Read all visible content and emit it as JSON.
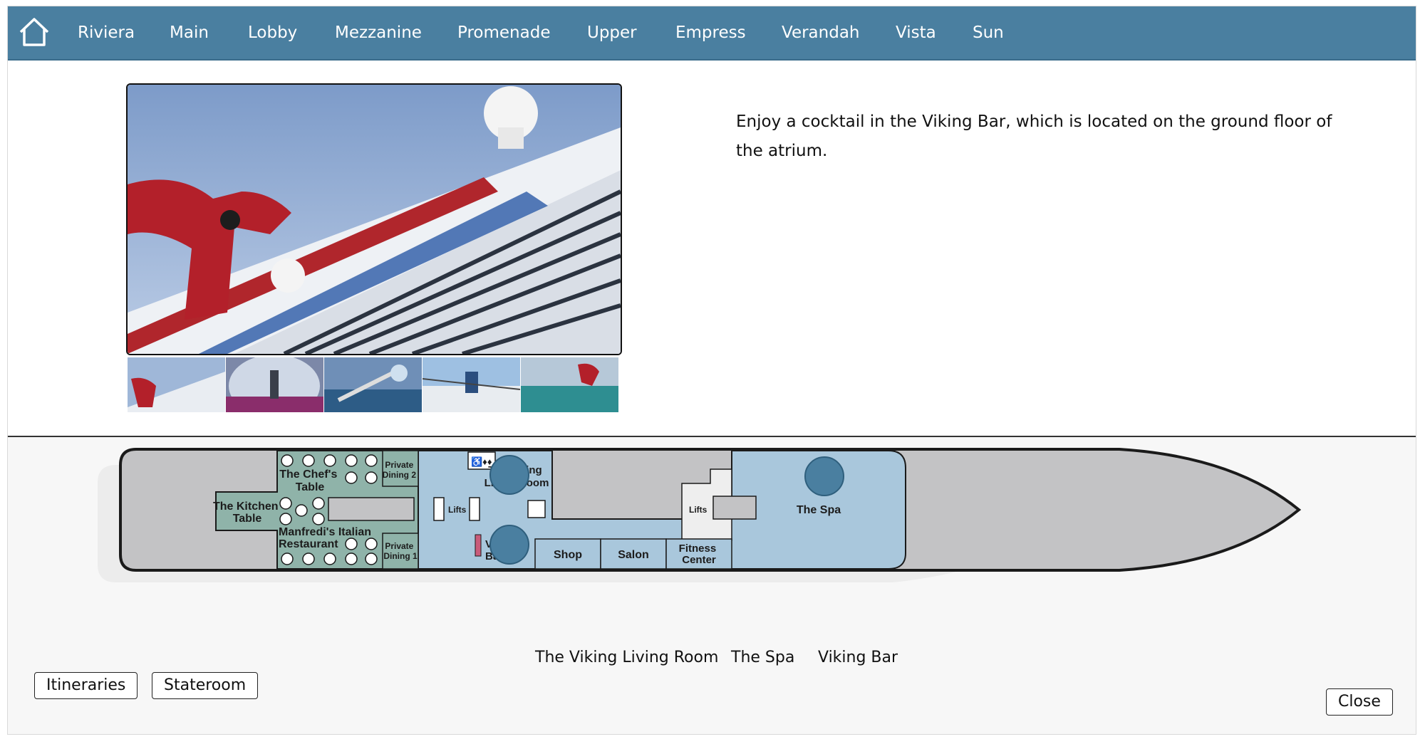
{
  "nav": {
    "home_icon": "home-icon",
    "items": [
      "Riviera",
      "Main",
      "Lobby",
      "Mezzanine",
      "Promenade",
      "Upper",
      "Empress",
      "Verandah",
      "Vista",
      "Sun"
    ]
  },
  "gallery": {
    "thumbnail_count": 5
  },
  "description": "Enjoy a cocktail in the Viking Bar, which is located on the ground floor of the atrium.",
  "deck_map": {
    "labels": {
      "kitchen_table": [
        "The Kitchen",
        "Table"
      ],
      "chefs_table": [
        "The Chef's",
        "Table"
      ],
      "manfredis": [
        "Manfredi's Italian",
        "Restaurant"
      ],
      "private_dining_2": [
        "Private",
        "Dining 2"
      ],
      "private_dining_1": [
        "Private",
        "Dining 1"
      ],
      "lifts_aft": "Lifts",
      "lifts_fwd": "Lifts",
      "living_room": [
        "The Viking",
        "Living Room"
      ],
      "viking_bar": [
        "Viking",
        "Bar"
      ],
      "shop": "Shop",
      "salon": "Salon",
      "fitness": [
        "Fitness",
        "Center"
      ],
      "spa": "The Spa"
    },
    "colors": {
      "hull": "#c3c3c5",
      "dining": "#8fb3a9",
      "public": "#a9c7dc",
      "marker": "#4a7fa0"
    }
  },
  "legend": [
    "The Viking Living Room",
    "The Spa",
    "Viking Bar"
  ],
  "buttons": {
    "itineraries": "Itineraries",
    "stateroom": "Stateroom",
    "close": "Close"
  }
}
